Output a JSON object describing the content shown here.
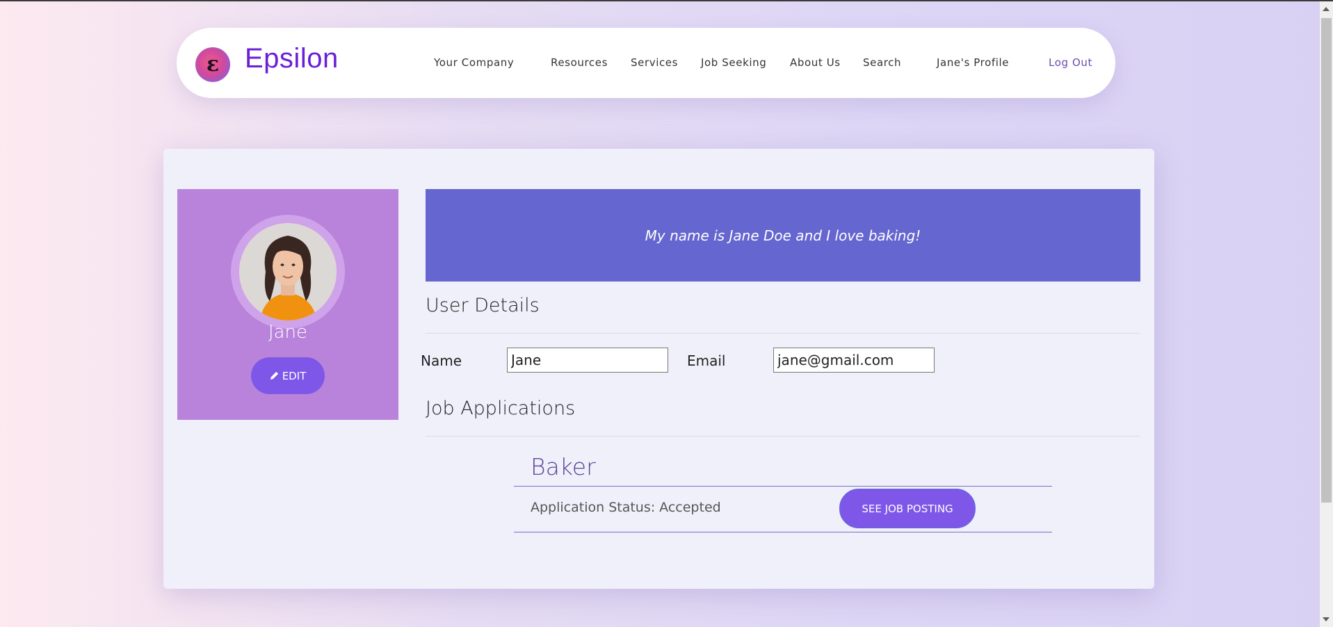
{
  "nav": {
    "logo_letter": "ε",
    "brand": "Epsilon",
    "items": [
      "Your Company",
      "Resources",
      "Services",
      "Job Seeking",
      "About Us",
      "Search",
      "Jane's Profile"
    ],
    "logout": "Log Out"
  },
  "profile": {
    "name": "Jane",
    "edit_label": "EDIT",
    "bio": "My name is Jane Doe and I love baking!"
  },
  "user_details": {
    "title": "User Details",
    "name_label": "Name",
    "name_value": "Jane",
    "email_label": "Email",
    "email_value": "jane@gmail.com"
  },
  "job_applications": {
    "title": "Job Applications",
    "items": [
      {
        "title": "Baker",
        "status": "Application Status: Accepted",
        "button": "SEE JOB POSTING"
      }
    ]
  },
  "colors": {
    "brand": "#6a1fd8",
    "sidebar": "#b983dc",
    "bio_bg": "#6566cf",
    "button": "#7f57e8"
  }
}
